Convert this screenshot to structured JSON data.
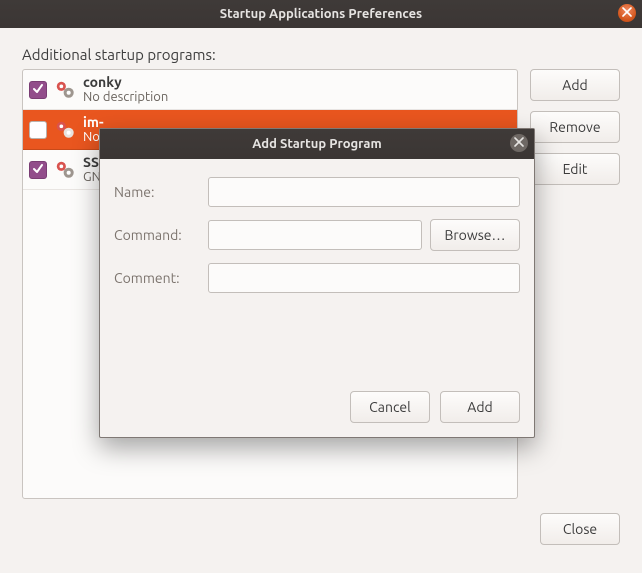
{
  "window": {
    "title": "Startup Applications Preferences"
  },
  "main": {
    "list_label": "Additional startup programs:",
    "rows": [
      {
        "checked": true,
        "name": "conky",
        "desc": "No description"
      },
      {
        "checked": false,
        "name": "im-",
        "desc": "No"
      },
      {
        "checked": true,
        "name": "SSI",
        "desc": "GN"
      }
    ],
    "buttons": {
      "add": "Add",
      "remove": "Remove",
      "edit": "Edit"
    },
    "close": "Close"
  },
  "dialog": {
    "title": "Add Startup Program",
    "fields": {
      "name_label": "Name:",
      "command_label": "Command:",
      "comment_label": "Comment:",
      "name_value": "",
      "command_value": "",
      "comment_value": ""
    },
    "browse": "Browse…",
    "cancel": "Cancel",
    "add": "Add"
  }
}
